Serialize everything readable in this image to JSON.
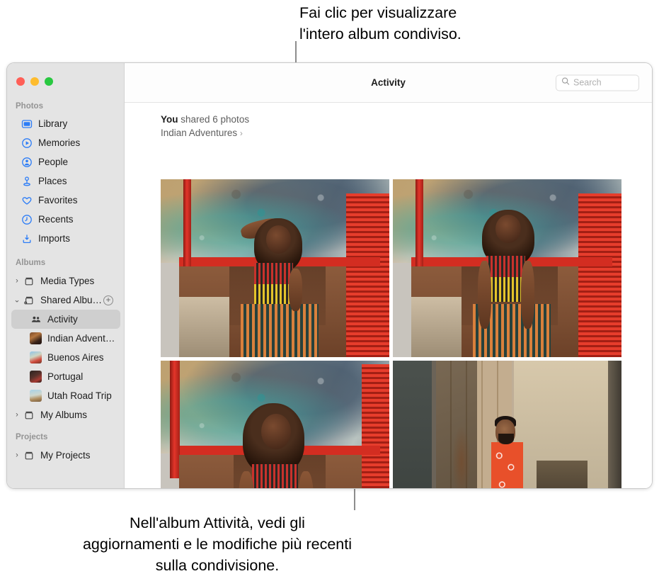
{
  "callouts": {
    "top": "Fai clic per visualizzare\nl'intero album condiviso.",
    "bottom": "Nell'album Attività, vedi gli aggiornamenti e le modifiche più recenti sulla condivisione."
  },
  "window": {
    "traffic_lights": {
      "close_label": "close",
      "minimize_label": "minimize",
      "zoom_label": "zoom",
      "close_color": "#ff5f57",
      "minimize_color": "#febc2e",
      "zoom_color": "#28c840"
    }
  },
  "sidebar": {
    "sections": [
      {
        "title": "Photos",
        "items": [
          {
            "label": "Library",
            "icon": "library-icon"
          },
          {
            "label": "Memories",
            "icon": "memories-icon"
          },
          {
            "label": "People",
            "icon": "people-icon"
          },
          {
            "label": "Places",
            "icon": "places-icon"
          },
          {
            "label": "Favorites",
            "icon": "heart-icon"
          },
          {
            "label": "Recents",
            "icon": "clock-icon"
          },
          {
            "label": "Imports",
            "icon": "import-icon"
          }
        ]
      },
      {
        "title": "Albums",
        "items": [
          {
            "label": "Media Types",
            "icon": "album-box-icon",
            "twisty": "›"
          },
          {
            "label": "Shared Albu…",
            "icon": "shared-album-icon",
            "twisty": "⌄",
            "add_label": "+"
          },
          {
            "label": "Activity",
            "icon": "activity-people-icon",
            "selected": true
          },
          {
            "label": "Indian Advent…",
            "thumb": "th-indian"
          },
          {
            "label": "Buenos Aires",
            "thumb": "th-buenos"
          },
          {
            "label": "Portugal",
            "thumb": "th-portugal"
          },
          {
            "label": "Utah Road Trip",
            "thumb": "th-utah"
          },
          {
            "label": "My Albums",
            "icon": "album-box-icon",
            "twisty": "›"
          }
        ]
      },
      {
        "title": "Projects",
        "items": [
          {
            "label": "My Projects",
            "icon": "album-box-icon",
            "twisty": "›"
          }
        ]
      }
    ]
  },
  "toolbar": {
    "title": "Activity",
    "search_placeholder": "Search",
    "search_value": ""
  },
  "activity": {
    "actor": "You",
    "action": " shared 6 photos",
    "album": "Indian Adventures",
    "chevron": "›",
    "photos": [
      {
        "alt": "Woman in striped dress seated against red and teal wall, hand raised to head"
      },
      {
        "alt": "Woman in striped dress seated against red and teal wall, looking aside"
      },
      {
        "alt": "Woman in striped dress with eyes closed in sunlight"
      },
      {
        "alt": "Man in orange printed kurta beside weathered wooden door"
      }
    ]
  },
  "colors": {
    "sidebar_bg": "#e4e4e4",
    "selected_row": "#cfcfcf",
    "accent_blue": "#2b7cf7",
    "text_primary": "#1c1c1c",
    "text_secondary": "#5e5e5e",
    "section_header": "#949494"
  }
}
